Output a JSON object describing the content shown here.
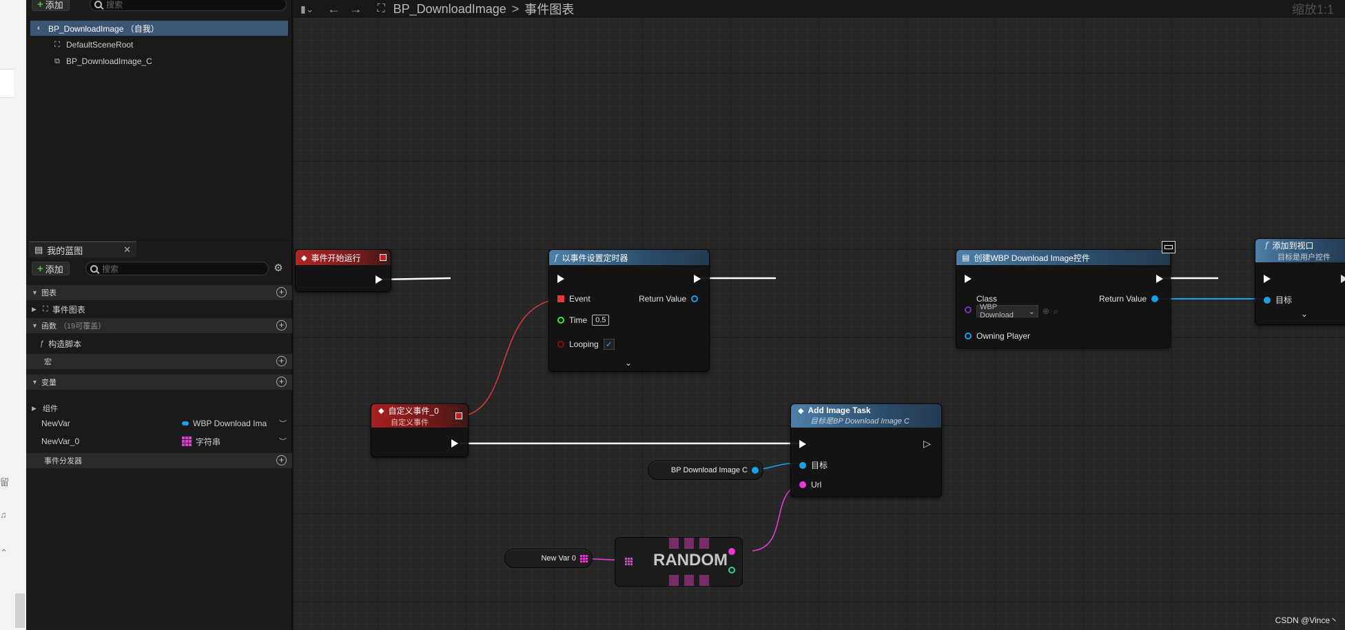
{
  "components_panel": {
    "add_button": "添加",
    "search_placeholder": "搜索",
    "tree": [
      {
        "label": "BP_DownloadImage （自我）",
        "icon": "actor-icon",
        "selected": true
      },
      {
        "label": "DefaultSceneRoot",
        "icon": "scene-root-icon"
      },
      {
        "label": "BP_DownloadImage_C",
        "icon": "widget-component-icon"
      }
    ]
  },
  "my_blueprint": {
    "tab_label": "我的蓝图",
    "add_button": "添加",
    "search_placeholder": "搜索",
    "sections": {
      "graphs": "图表",
      "event_graph": "事件图表",
      "functions": "函数",
      "functions_hint": "（19可覆盖）",
      "construction_script": "构造脚本",
      "macros": "宏",
      "variables": "变量",
      "components": "组件",
      "event_dispatchers": "事件分发器"
    },
    "variables": [
      {
        "name": "NewVar",
        "type": "WBP Download Ima",
        "type_color": "#1aa0e8"
      },
      {
        "name": "NewVar_0",
        "type": "字符串",
        "type_color": "#e83ad8"
      }
    ]
  },
  "graph": {
    "breadcrumb_root": "BP_DownloadImage",
    "breadcrumb_separator": ">",
    "breadcrumb_current": "事件图表",
    "zoom_label": "缩放1:1",
    "watermark": "CSDN @Vince丶",
    "nodes": {
      "begin_play": {
        "title": "事件开始运行"
      },
      "set_timer": {
        "title": "以事件设置定时器",
        "pin_event": "Event",
        "pin_return": "Return Value",
        "pin_time": "Time",
        "time_value": "0.5",
        "pin_looping": "Looping",
        "looping_checked": "✓"
      },
      "create_widget": {
        "title": "创建WBP Download Image控件",
        "pin_class": "Class",
        "class_value": "WBP Download",
        "pin_return": "Return Value",
        "pin_owner": "Owning Player"
      },
      "add_to_viewport": {
        "title": "添加到视口",
        "subtitle": "目标是用户控件",
        "pin_target": "目标"
      },
      "custom_event": {
        "title": "自定义事件_0",
        "subtitle": "自定义事件"
      },
      "add_image_task": {
        "title": "Add Image Task",
        "subtitle": "目标是BP Download Image C",
        "pin_target": "目标",
        "pin_url": "Url"
      },
      "self_ref": {
        "label": "BP Download Image C"
      },
      "new_var_0": {
        "label": "New Var 0"
      },
      "random": {
        "label": "RANDOM"
      }
    }
  },
  "colors": {
    "exec_wire": "#ffffff",
    "object_pin": "#1aa0e8",
    "string_pin": "#e83ad8",
    "delegate_pin": "#e83a3a",
    "float_pin": "#3ae83a",
    "bool_pin": "#8a0f0f",
    "selection": "#3b5775"
  }
}
